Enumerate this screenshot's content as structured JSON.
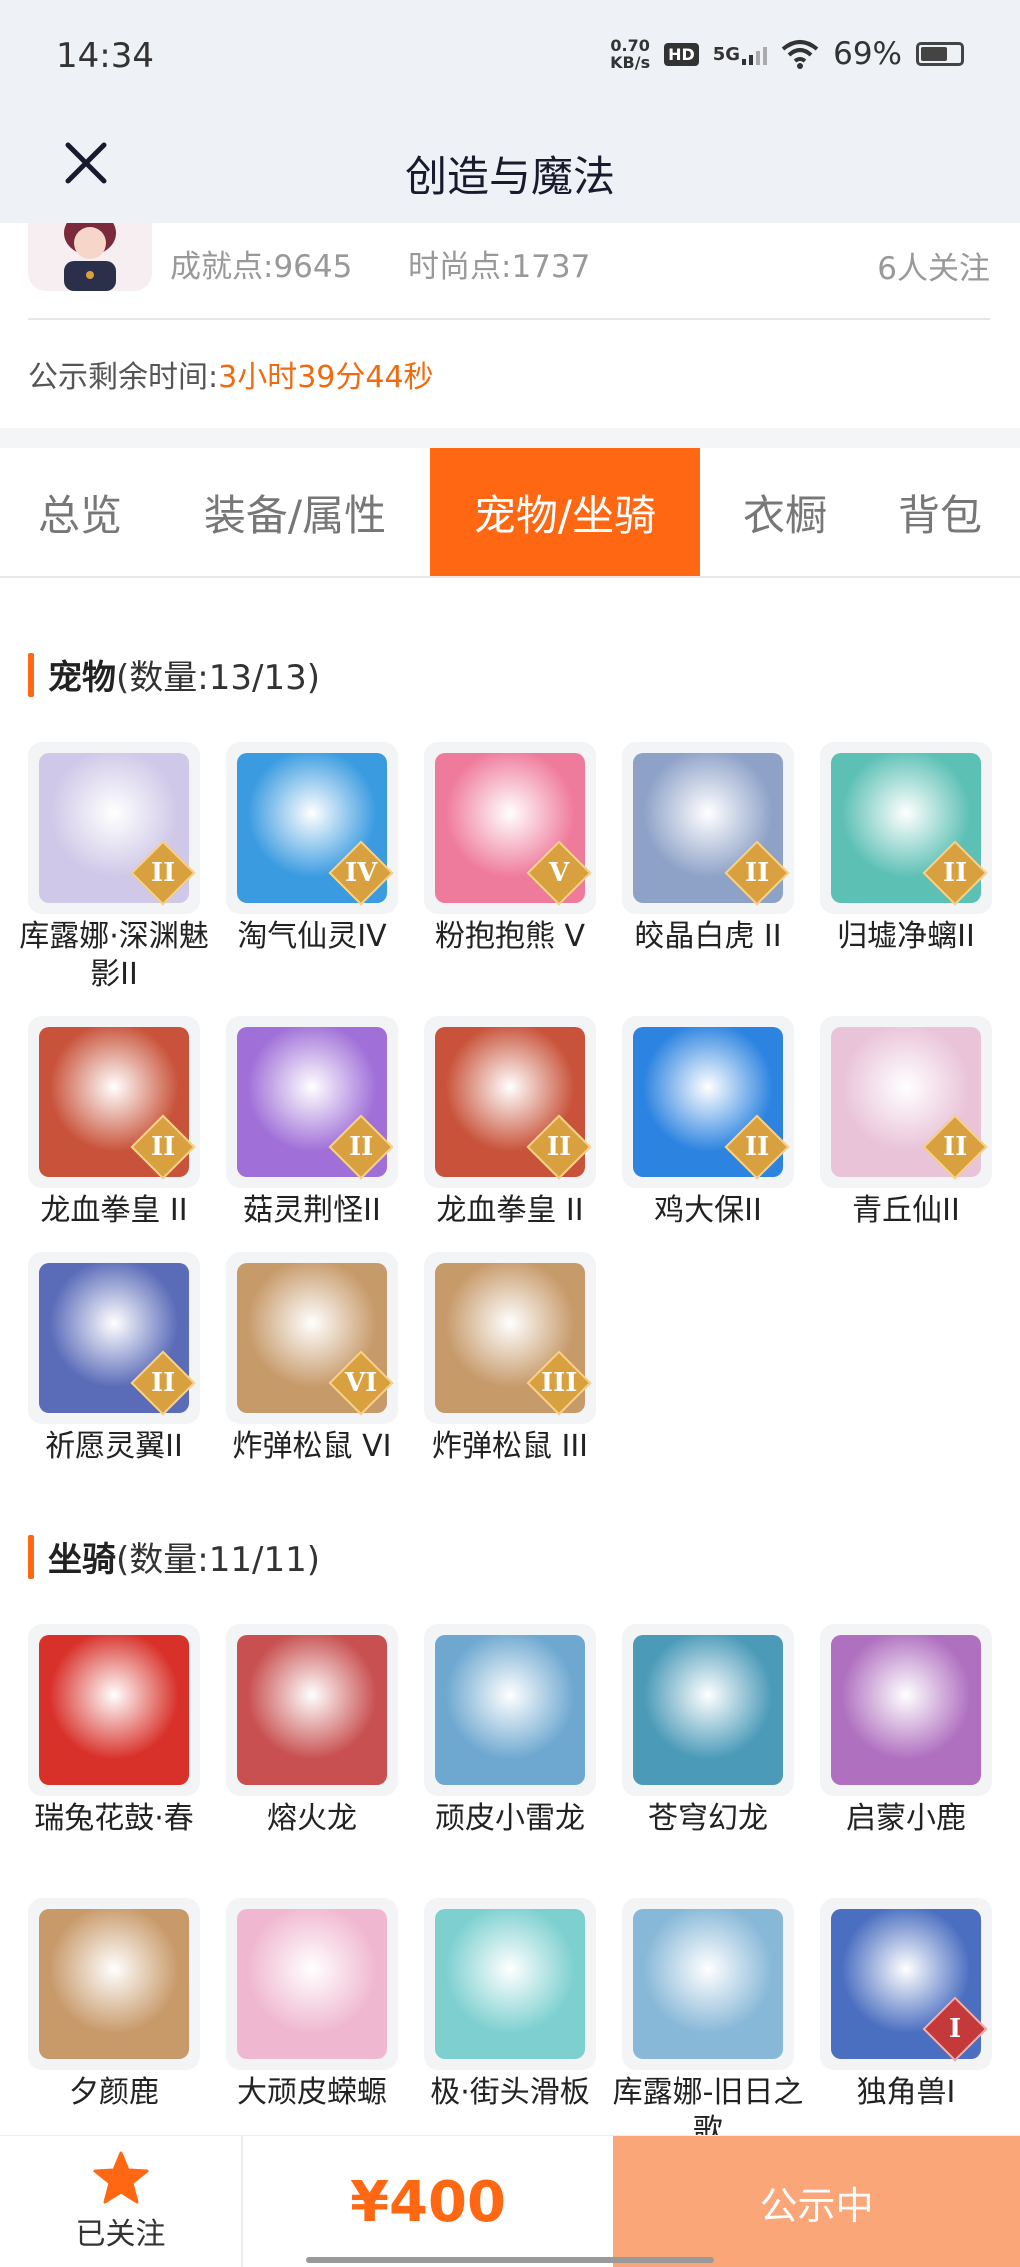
{
  "status": {
    "time": "14:34",
    "net_speed_value": "0.70",
    "net_speed_unit": "KB/s",
    "hd": "HD",
    "signal": "5G",
    "battery": "69%"
  },
  "nav": {
    "title": "创造与魔法",
    "close_icon": "close-icon"
  },
  "profile": {
    "achievement": "成就点:9645",
    "fashion": "时尚点:1737",
    "followers": "6人关注"
  },
  "countdown": {
    "label": "公示剩余时间:",
    "value": "3小时39分44秒"
  },
  "tabs": [
    {
      "label": "总览"
    },
    {
      "label": "装备/属性"
    },
    {
      "label": "宠物/坐骑",
      "active": true
    },
    {
      "label": "衣橱"
    },
    {
      "label": "背包"
    }
  ],
  "pets": {
    "title": "宠物",
    "count": "(数量:13/13)",
    "items": [
      {
        "name": "库露娜·深渊魅影II",
        "rank": "II",
        "color": "#cfc8e8"
      },
      {
        "name": "淘气仙灵IV",
        "rank": "IV",
        "color": "#3a9be0"
      },
      {
        "name": "粉抱抱熊 V",
        "rank": "V",
        "color": "#ef7b9c"
      },
      {
        "name": "皎晶白虎 II",
        "rank": "II",
        "color": "#8ea2c8"
      },
      {
        "name": "归墟净螭II",
        "rank": "II",
        "color": "#5cc0b5"
      },
      {
        "name": "龙血拳皇 II",
        "rank": "II",
        "color": "#c8533a"
      },
      {
        "name": "菇灵荆怪II",
        "rank": "II",
        "color": "#a070d8"
      },
      {
        "name": "龙血拳皇 II",
        "rank": "II",
        "color": "#c8533a"
      },
      {
        "name": "鸡大保II",
        "rank": "II",
        "color": "#2d84e0"
      },
      {
        "name": "青丘仙II",
        "rank": "II",
        "color": "#e9c3d8"
      },
      {
        "name": "祈愿灵翼II",
        "rank": "II",
        "color": "#5a6bb8"
      },
      {
        "name": "炸弹松鼠 VI",
        "rank": "VI",
        "color": "#c79a6a"
      },
      {
        "name": "炸弹松鼠 III",
        "rank": "III",
        "color": "#c79a6a"
      }
    ]
  },
  "mounts": {
    "title": "坐骑",
    "count": "(数量:11/11)",
    "items": [
      {
        "name": "瑞兔花鼓·春",
        "rank": "",
        "color": "#d8312a"
      },
      {
        "name": "熔火龙",
        "rank": "",
        "color": "#c85050"
      },
      {
        "name": "顽皮小雷龙",
        "rank": "",
        "color": "#6ea8d0"
      },
      {
        "name": "苍穹幻龙",
        "rank": "",
        "color": "#4a9ab8"
      },
      {
        "name": "启蒙小鹿",
        "rank": "",
        "color": "#b070c0"
      },
      {
        "name": "夕颜鹿",
        "rank": "",
        "color": "#c89a6a"
      },
      {
        "name": "大顽皮蝾螈",
        "rank": "",
        "color": "#f0b8d0"
      },
      {
        "name": "极·街头滑板",
        "rank": "",
        "color": "#7ed0d0"
      },
      {
        "name": "库露娜-旧日之歌",
        "rank": "",
        "color": "#88b8d8"
      },
      {
        "name": "独角兽I",
        "rank": "I",
        "color": "#4a6ec0"
      }
    ]
  },
  "bottom": {
    "follow_label": "已关注",
    "price": "¥400",
    "status_button": "公示中"
  },
  "colors": {
    "accent": "#ff6712",
    "countdown": "#f06b10",
    "button_bg": "#fba679"
  }
}
